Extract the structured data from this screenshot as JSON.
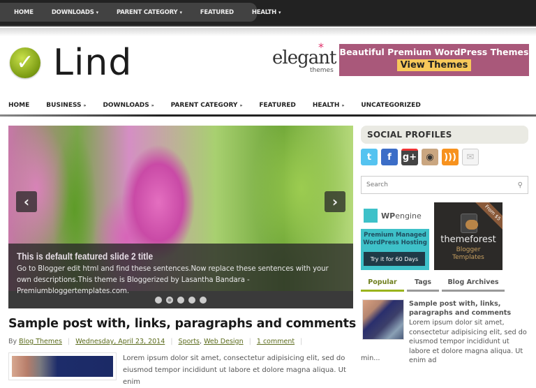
{
  "top_nav": {
    "items": [
      {
        "label": "HOME",
        "has_submenu": false
      },
      {
        "label": "DOWNLOADS",
        "has_submenu": true
      },
      {
        "label": "PARENT CATEGORY",
        "has_submenu": true
      },
      {
        "label": "FEATURED",
        "has_submenu": false
      },
      {
        "label": "HEALTH",
        "has_submenu": true
      }
    ],
    "submenu_glyph": "▾"
  },
  "header": {
    "logo_text": "Lind",
    "logo_icon": "check-mark-icon",
    "logo_glyph": "✓",
    "ad_brand": {
      "name": "elegant",
      "tagline": "themes",
      "asterisk": "*"
    },
    "ad_banner": {
      "headline": "Beautiful Premium WordPress Themes",
      "button": "View Themes",
      "bg_color": "#a9587a",
      "button_color": "#f7c85a"
    }
  },
  "main_nav": {
    "items": [
      {
        "label": "HOME",
        "has_submenu": false
      },
      {
        "label": "BUSINESS",
        "has_submenu": true
      },
      {
        "label": "DOWNLOADS",
        "has_submenu": true
      },
      {
        "label": "PARENT CATEGORY",
        "has_submenu": true
      },
      {
        "label": "FEATURED",
        "has_submenu": false
      },
      {
        "label": "HEALTH",
        "has_submenu": true
      },
      {
        "label": "UNCATEGORIZED",
        "has_submenu": false
      }
    ],
    "submenu_glyph": "»"
  },
  "slider": {
    "title": "This is default featured slide 2 title",
    "description": "Go to Blogger edit html and find these sentences.Now replace these sentences with your own descriptions.This theme is Bloggerized by Lasantha Bandara - Premiumbloggertemplates.com.",
    "prev_glyph": "‹",
    "next_glyph": "›",
    "slide_count": 5,
    "active_slide": 2
  },
  "post": {
    "title": "Sample post with, links, paragraphs and comments",
    "by_label": "By",
    "author": "Blog Themes",
    "date": "Wednesday, April 23, 2014",
    "categories": [
      "Sports",
      "Web Design"
    ],
    "category_separator": ",",
    "comments": "1 comment",
    "meta_separator": "|",
    "excerpt": "Lorem ipsum dolor sit amet, consectetur adipisicing elit, sed do eiusmod tempor incididunt ut labore et dolore magna aliqua. Ut enim"
  },
  "sidebar": {
    "social_title": "SOCIAL PROFILES",
    "social_icons": [
      {
        "name": "twitter",
        "glyph": "t"
      },
      {
        "name": "facebook",
        "glyph": "f"
      },
      {
        "name": "google-plus",
        "glyph": "g+"
      },
      {
        "name": "instagram",
        "glyph": "◉"
      },
      {
        "name": "rss",
        "glyph": ")))"
      },
      {
        "name": "email",
        "glyph": "✉"
      }
    ],
    "search_placeholder": "Search",
    "search_glyph": "🔍",
    "ad_wpengine": {
      "brand_bold": "WP",
      "brand_rest": "engine",
      "tagline": "Premium Managed WordPress Hosting",
      "button": "Try it for 60 Days"
    },
    "ad_themeforest": {
      "ribbon": "From $5",
      "name": "themeforest",
      "sub1": "Blogger",
      "sub2": "Templates"
    },
    "tabs": [
      {
        "label": "Popular",
        "active": true
      },
      {
        "label": "Tags",
        "active": false
      },
      {
        "label": "Blog Archives",
        "active": false
      }
    ],
    "popular_post": {
      "title": "Sample post with, links, paragraphs and comments",
      "excerpt": "Lorem ipsum dolor sit amet, consectetur adipisicing elit, sed do eiusmod tempor incididunt ut labore et dolore magna aliqua. Ut enim ad",
      "more": "min..."
    }
  }
}
